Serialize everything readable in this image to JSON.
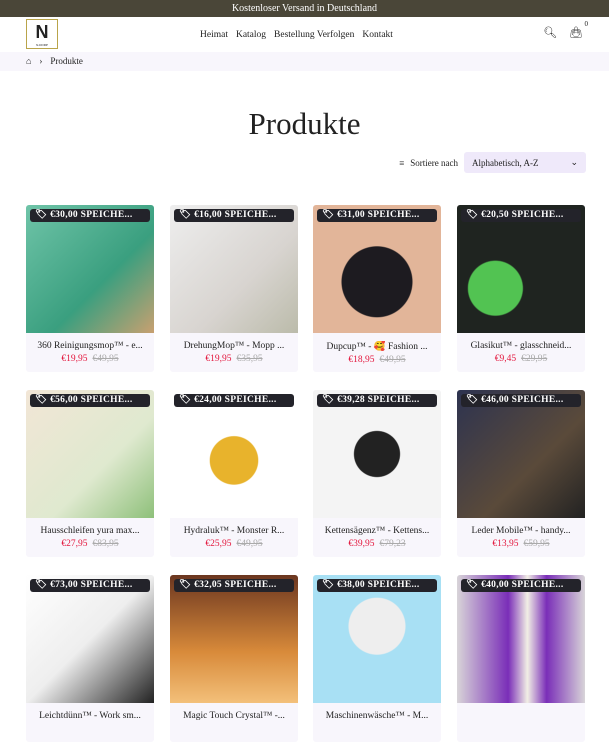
{
  "announcement": "Kostenloser Versand in Deutschland",
  "logo": {
    "letter": "N",
    "sub": "N-DORP"
  },
  "nav": [
    "Heimat",
    "Katalog",
    "Bestellung Verfolgen",
    "Kontakt"
  ],
  "cart_count": "0",
  "breadcrumb": {
    "current": "Produkte"
  },
  "page_title": "Produkte",
  "sort": {
    "label": "Sortiere nach",
    "value": "Alphabetisch, A-Z"
  },
  "colors": {
    "sale": "#e3173d",
    "announce_bg": "#4a4638"
  },
  "products": [
    {
      "badge": "€30,00 SPEICHE...",
      "title": "360 Reinigungsmop™ - e...",
      "price": "€19,95",
      "old": "€49,95",
      "bg": "linear-gradient(135deg,#6fc4a8,#3a9f7f 60%,#c8a070)"
    },
    {
      "badge": "€16,00 SPEICHE...",
      "title": "DrehungMop™ - Mopp ...",
      "price": "€19,95",
      "old": "€35,95",
      "bg": "linear-gradient(135deg,#eee,#d8d4d0 60%,#bba)"
    },
    {
      "badge": "€31,00 SPEICHE...",
      "title": "Dupcup™ - 🥰 Fashion ...",
      "price": "€18,95",
      "old": "€49,95",
      "bg": "radial-gradient(circle at 50% 60%,#1d1b20 35%,#e2b599 36%)"
    },
    {
      "badge": "€20,50 SPEICHE...",
      "title": "Glasikut™ - glasschneid...",
      "price": "€9,45",
      "old": "€29,95",
      "bg": "radial-gradient(circle at 30% 65%,#52c352 22%,#1f2420 23%)"
    },
    {
      "badge": "€56,00 SPEICHE...",
      "title": "Hausschleifen yura max...",
      "price": "€27,95",
      "old": "€83,95",
      "bg": "linear-gradient(135deg,#f2e6d6,#dfe9cf 60%,#8ec07a)"
    },
    {
      "badge": "€24,00 SPEICHE...",
      "title": "Hydraluk™ - Monster R...",
      "price": "€25,95",
      "old": "€49,95",
      "bg": "radial-gradient(circle at 50% 55%,#e8b32c 25%,#fff 26%)"
    },
    {
      "badge": "€39,28 SPEICHE...",
      "title": "Kettensägenz™ - Kettens...",
      "price": "€39,95",
      "old": "€79,23",
      "bg": "radial-gradient(circle at 50% 50%,#222 25%,#f4f4f4 26%)"
    },
    {
      "badge": "€46,00 SPEICHE...",
      "title": "Leder Mobile™ - handy...",
      "price": "€13,95",
      "old": "€59,95",
      "bg": "linear-gradient(135deg,#2d3350,#5a4a3a 60%,#222)"
    },
    {
      "badge": "€73,00 SPEICHE...",
      "title": "Leichtdünn™ - Work sm...",
      "price": "",
      "old": "",
      "bg": "linear-gradient(135deg,#fff,#eee 50%,#222)"
    },
    {
      "badge": "€32,05 SPEICHE...",
      "title": "Magic Touch Crystal™ -...",
      "price": "",
      "old": "",
      "bg": "linear-gradient(180deg,#6b3620,#d88a3a 60%,#f3c07a)"
    },
    {
      "badge": "€38,00 SPEICHE...",
      "title": "Maschinenwäsche™ - M...",
      "price": "",
      "old": "",
      "bg": "radial-gradient(circle at 50% 40%,#eee 28%,#a8e0f4 29%)"
    },
    {
      "badge": "€40,00 SPEICHE...",
      "title": "",
      "price": "",
      "old": "",
      "bg": "linear-gradient(90deg,#d8d4d8,#7a2eb8 40%,#f2efe5 55%,#7a2eb8 70%,#d8d4d8)"
    }
  ]
}
